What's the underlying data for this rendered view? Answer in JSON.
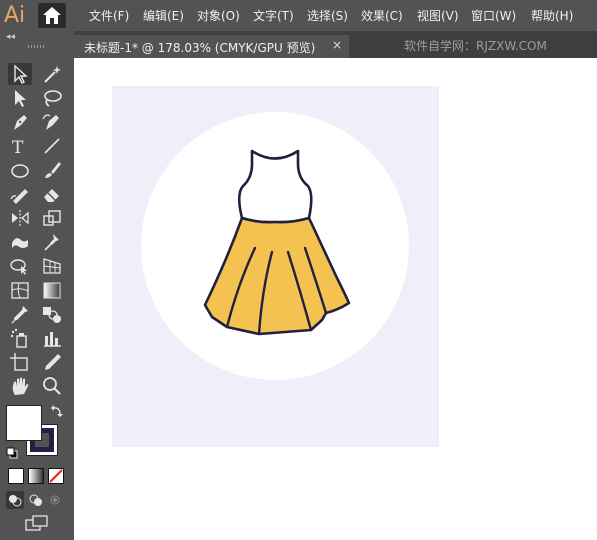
{
  "app": {
    "logo_text": "Ai"
  },
  "menu": {
    "items": [
      {
        "id": "file",
        "label": "文件(F)"
      },
      {
        "id": "edit",
        "label": "编辑(E)"
      },
      {
        "id": "object",
        "label": "对象(O)"
      },
      {
        "id": "type",
        "label": "文字(T)"
      },
      {
        "id": "select",
        "label": "选择(S)"
      },
      {
        "id": "effect",
        "label": "效果(C)"
      },
      {
        "id": "view",
        "label": "视图(V)"
      },
      {
        "id": "window",
        "label": "窗口(W)"
      },
      {
        "id": "help",
        "label": "帮助(H)"
      }
    ]
  },
  "tabs": {
    "collapse_glyph": "◂◂",
    "document_title": "未标题-1* @ 178.03% (CMYK/GPU 预览)",
    "close_glyph": "×"
  },
  "watermark": "软件自学网：RJZXW.COM",
  "toolbar": {
    "tools": [
      "selection-tool-icon",
      "magic-wand-tool-icon",
      "direct-selection-tool-icon",
      "lasso-tool-icon",
      "pen-tool-icon",
      "curvature-tool-icon",
      "type-tool-icon",
      "line-segment-tool-icon",
      "ellipse-tool-icon",
      "paintbrush-tool-icon",
      "shaper-tool-icon",
      "eraser-tool-icon",
      "reflect-tool-icon",
      "scale-tool-icon",
      "puppet-warp-tool-icon",
      "pin-tool-icon",
      "shape-builder-tool-icon",
      "perspective-grid-tool-icon",
      "mesh-tool-icon",
      "gradient-tool-icon",
      "eyedropper-tool-icon",
      "blend-tool-icon",
      "symbol-sprayer-tool-icon",
      "column-graph-tool-icon",
      "artboard-tool-icon",
      "slice-tool-icon",
      "hand-tool-icon",
      "zoom-tool-icon"
    ],
    "fill_color": "#ffffff",
    "stroke_color": "#1e2047",
    "type_glyph": "T"
  },
  "colors": {
    "menubar": "#535353",
    "artboard": "#eeeff8",
    "dress_top": "#ffffff",
    "dress_skirt": "#f4c250",
    "dress_outline": "#23203f"
  }
}
